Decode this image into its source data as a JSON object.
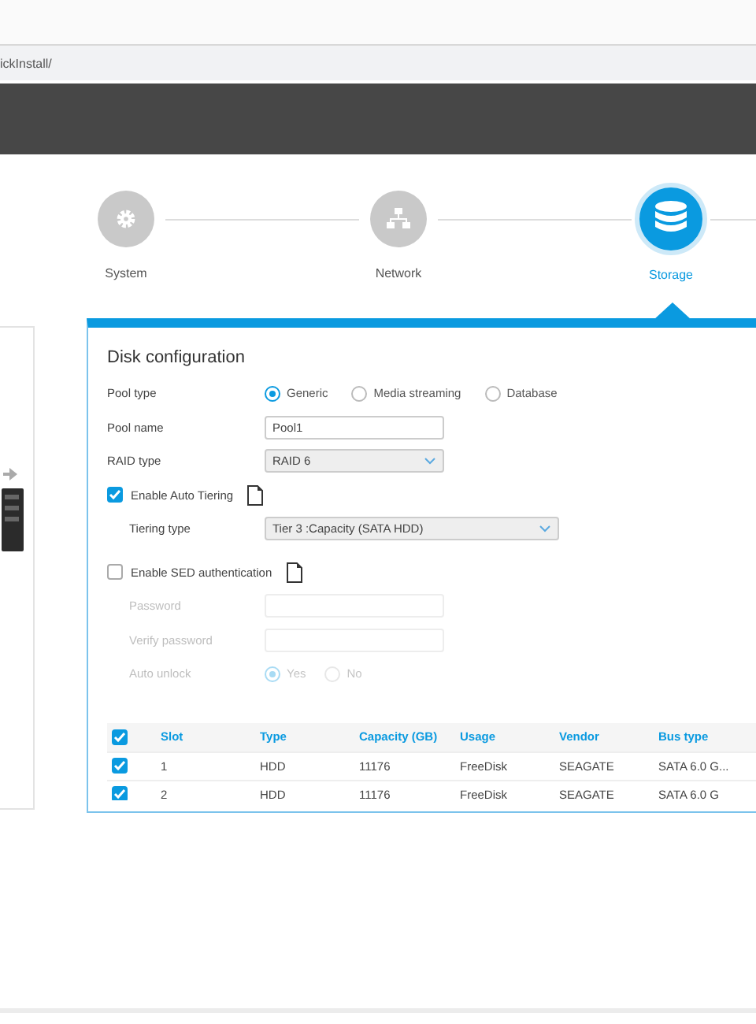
{
  "browser": {
    "address": "ickInstall/"
  },
  "steps": [
    {
      "label": "System",
      "kind": "gear",
      "selected": false
    },
    {
      "label": "Network",
      "kind": "network",
      "selected": false
    },
    {
      "label": "Storage",
      "kind": "database",
      "selected": true
    }
  ],
  "disk_config": {
    "title": "Disk configuration",
    "pool_type": {
      "label": "Pool type",
      "options": [
        {
          "label": "Generic",
          "selected": true
        },
        {
          "label": "Media streaming",
          "selected": false
        },
        {
          "label": "Database",
          "selected": false
        }
      ]
    },
    "pool_name": {
      "label": "Pool name",
      "value": "Pool1"
    },
    "raid_type": {
      "label": "RAID type",
      "value": "RAID 6"
    },
    "auto_tiering": {
      "label": "Enable Auto Tiering",
      "checked": true
    },
    "tiering_type": {
      "label": "Tiering type",
      "value": "Tier 3 :Capacity (SATA HDD)"
    },
    "sed": {
      "label": "Enable SED authentication",
      "checked": false
    },
    "password": {
      "label": "Password"
    },
    "verify_password": {
      "label": "Verify password"
    },
    "auto_unlock": {
      "label": "Auto unlock",
      "options": [
        {
          "label": "Yes",
          "selected": true
        },
        {
          "label": "No",
          "selected": false
        }
      ]
    }
  },
  "table": {
    "all_checked": true,
    "columns": [
      "Slot",
      "Type",
      "Capacity (GB)",
      "Usage",
      "Vendor",
      "Bus type"
    ],
    "rows": [
      {
        "checked": true,
        "cells": [
          "1",
          "HDD",
          "11176",
          "FreeDisk",
          "SEAGATE",
          "SATA 6.0 G..."
        ]
      },
      {
        "checked": true,
        "cells": [
          "2",
          "HDD",
          "11176",
          "FreeDisk",
          "SEAGATE",
          "SATA 6.0 G"
        ]
      }
    ]
  }
}
